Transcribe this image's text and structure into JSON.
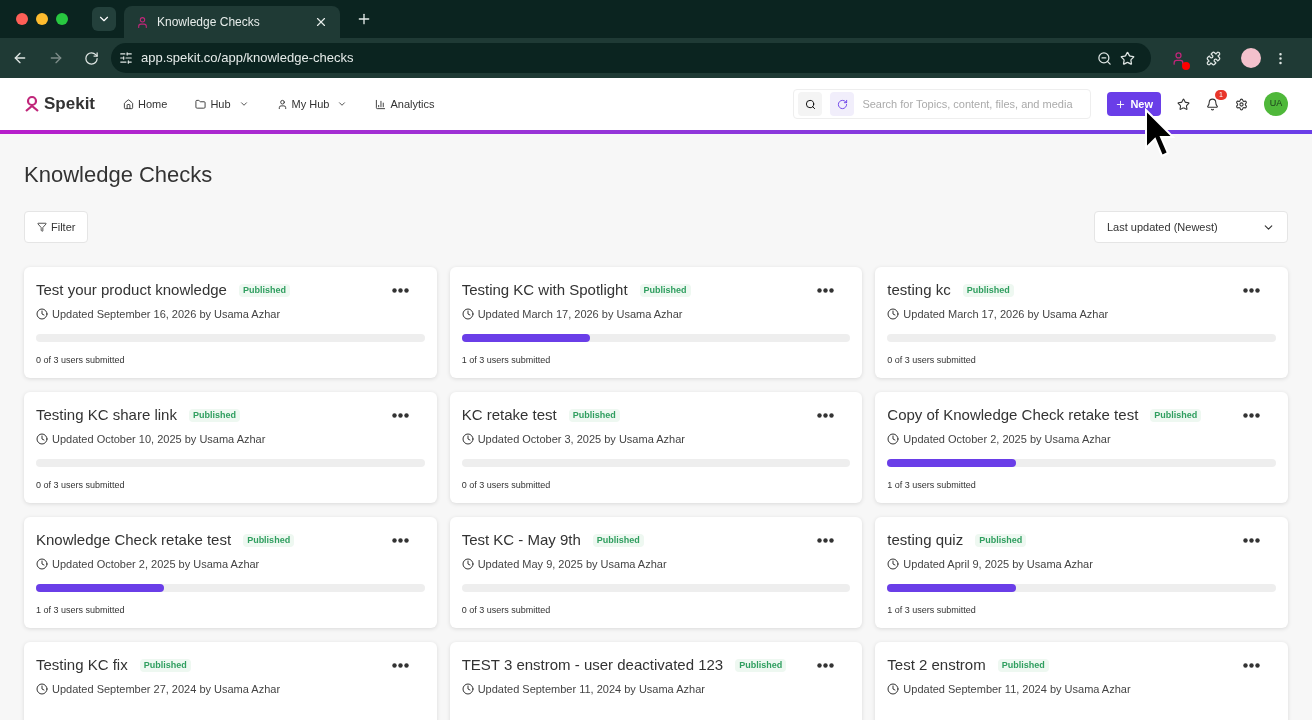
{
  "browser": {
    "tab_title": "Knowledge Checks",
    "url": "app.spekit.co/app/knowledge-checks"
  },
  "header": {
    "logo": "Spekit",
    "nav": [
      {
        "label": "Home",
        "kind": "home",
        "dropdown": false
      },
      {
        "label": "Hub",
        "kind": "folder",
        "dropdown": true
      },
      {
        "label": "My Hub",
        "kind": "user",
        "dropdown": true
      },
      {
        "label": "Analytics",
        "kind": "chart",
        "dropdown": false
      }
    ],
    "search": {
      "placeholder": "Search for Topics, content, files, and media"
    },
    "new_button": "New",
    "notification_count": "1",
    "avatar": "UA"
  },
  "page": {
    "title": "Knowledge Checks",
    "filter": "Filter",
    "sort": "Last updated (Newest)"
  },
  "cards": [
    {
      "title": "Test your product knowledge",
      "status": "Published",
      "updated": "Updated September 16, 2026 by Usama Azhar",
      "submitted": "0 of 3 users submitted"
    },
    {
      "title": "Testing KC with Spotlight",
      "status": "Published",
      "updated": "Updated March 17, 2026 by Usama Azhar",
      "level": 0.33,
      "submitted": "1 of 3 users submitted"
    },
    {
      "title": "testing kc",
      "status": "Published",
      "updated": "Updated March 17, 2026 by Usama Azhar",
      "submitted": "0 of 3 users submitted"
    },
    {
      "title": "Testing KC share link",
      "status": "Published",
      "updated": "Updated October 10, 2025 by Usama Azhar",
      "submitted": "0 of 3 users submitted"
    },
    {
      "title": "KC retake test",
      "status": "Published",
      "updated": "Updated October 3, 2025 by Usama Azhar",
      "submitted": "0 of 3 users submitted"
    },
    {
      "title": "Copy of Knowledge Check retake test",
      "status": "Published",
      "updated": "Updated October 2, 2025 by Usama Azhar",
      "level": 0.33,
      "submitted": "1 of 3 users submitted"
    },
    {
      "title": "Knowledge Check retake test",
      "status": "Published",
      "updated": "Updated October 2, 2025 by Usama Azhar",
      "level": 0.33,
      "submitted": "1 of 3 users submitted"
    },
    {
      "title": "Test KC - May 9th",
      "status": "Published",
      "updated": "Updated May 9, 2025 by Usama Azhar",
      "submitted": "0 of 3 users submitted"
    },
    {
      "title": "testing quiz",
      "status": "Published",
      "updated": "Updated April 9, 2025 by Usama Azhar",
      "level": 0.33,
      "submitted": "1 of 3 users submitted"
    },
    {
      "title": "Testing KC fix",
      "status": "Published",
      "updated": "Updated September 27, 2024 by Usama Azhar"
    },
    {
      "title": "TEST 3 enstrom - user deactivated 123",
      "status": "Published",
      "updated": "Updated September 11, 2024 by Usama Azhar"
    },
    {
      "title": "Test 2 enstrom",
      "status": "Published",
      "updated": "Updated September 11, 2024 by Usama Azhar"
    }
  ]
}
